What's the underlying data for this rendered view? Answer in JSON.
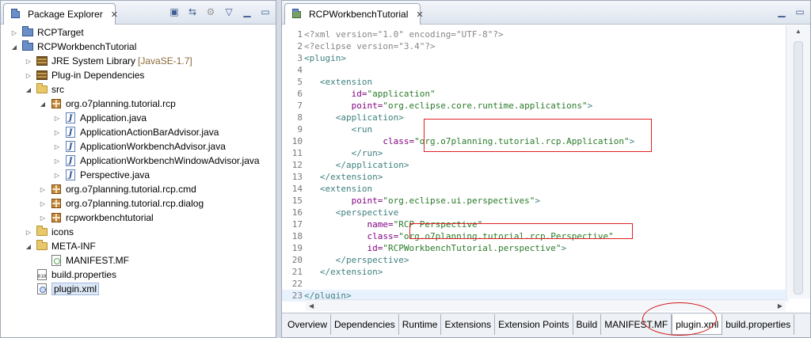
{
  "explorer": {
    "title": "Package Explorer",
    "tree": [
      {
        "label": "RCPTarget",
        "depth": 0,
        "icon": "project-icon",
        "twisty": "collapsed"
      },
      {
        "label": "RCPWorkbenchTutorial",
        "depth": 0,
        "icon": "project-icon",
        "twisty": "expanded"
      },
      {
        "label": "JRE System Library",
        "decoration": "[JavaSE-1.7]",
        "depth": 1,
        "icon": "library-icon",
        "twisty": "collapsed"
      },
      {
        "label": "Plug-in Dependencies",
        "depth": 1,
        "icon": "library-icon",
        "twisty": "collapsed"
      },
      {
        "label": "src",
        "depth": 1,
        "icon": "source-folder-icon",
        "twisty": "expanded"
      },
      {
        "label": "org.o7planning.tutorial.rcp",
        "depth": 2,
        "icon": "package-icon",
        "twisty": "expanded"
      },
      {
        "label": "Application.java",
        "depth": 3,
        "icon": "java-file-icon",
        "twisty": "collapsed"
      },
      {
        "label": "ApplicationActionBarAdvisor.java",
        "depth": 3,
        "icon": "java-file-icon",
        "twisty": "collapsed"
      },
      {
        "label": "ApplicationWorkbenchAdvisor.java",
        "depth": 3,
        "icon": "java-file-icon",
        "twisty": "collapsed"
      },
      {
        "label": "ApplicationWorkbenchWindowAdvisor.java",
        "depth": 3,
        "icon": "java-file-icon",
        "twisty": "collapsed"
      },
      {
        "label": "Perspective.java",
        "depth": 3,
        "icon": "java-file-icon",
        "twisty": "collapsed"
      },
      {
        "label": "org.o7planning.tutorial.rcp.cmd",
        "depth": 2,
        "icon": "package-icon",
        "twisty": "collapsed"
      },
      {
        "label": "org.o7planning.tutorial.rcp.dialog",
        "depth": 2,
        "icon": "package-icon",
        "twisty": "collapsed"
      },
      {
        "label": "rcpworkbenchtutorial",
        "depth": 2,
        "icon": "package-icon",
        "twisty": "collapsed"
      },
      {
        "label": "icons",
        "depth": 1,
        "icon": "folder-icon",
        "twisty": "collapsed"
      },
      {
        "label": "META-INF",
        "depth": 1,
        "icon": "folder-icon",
        "twisty": "expanded"
      },
      {
        "label": "MANIFEST.MF",
        "depth": 2,
        "icon": "manifest-file-icon",
        "twisty": "none"
      },
      {
        "label": "build.properties",
        "depth": 1,
        "icon": "properties-file-icon",
        "twisty": "none"
      },
      {
        "label": "plugin.xml",
        "depth": 1,
        "icon": "xml-file-icon",
        "twisty": "none",
        "selected": true
      }
    ]
  },
  "editor": {
    "title": "RCPWorkbenchTutorial",
    "lines": [
      {
        "n": "1",
        "parts": [
          [
            "pi",
            "<?xml version=\"1.0\" encoding=\"UTF-8\"?>"
          ]
        ]
      },
      {
        "n": "2",
        "parts": [
          [
            "pi",
            "<?eclipse version=\"3.4\"?>"
          ]
        ]
      },
      {
        "n": "3",
        "parts": [
          [
            "tag",
            "<plugin>"
          ]
        ]
      },
      {
        "n": "4",
        "parts": []
      },
      {
        "n": "5",
        "parts": [
          [
            "sp",
            "   "
          ],
          [
            "tag",
            "<extension"
          ]
        ]
      },
      {
        "n": "6",
        "parts": [
          [
            "sp",
            "         "
          ],
          [
            "attr",
            "id="
          ],
          [
            "val",
            "\"application\""
          ]
        ]
      },
      {
        "n": "7",
        "parts": [
          [
            "sp",
            "         "
          ],
          [
            "attr",
            "point="
          ],
          [
            "val",
            "\"org.eclipse.core.runtime.applications\""
          ],
          [
            "tag",
            ">"
          ]
        ]
      },
      {
        "n": "8",
        "parts": [
          [
            "sp",
            "      "
          ],
          [
            "tag",
            "<application>"
          ]
        ]
      },
      {
        "n": "9",
        "parts": [
          [
            "sp",
            "         "
          ],
          [
            "tag",
            "<run"
          ]
        ]
      },
      {
        "n": "10",
        "parts": [
          [
            "sp",
            "               "
          ],
          [
            "attr",
            "class="
          ],
          [
            "val",
            "\"org.o7planning.tutorial.rcp.Application\""
          ],
          [
            "tag",
            ">"
          ]
        ]
      },
      {
        "n": "11",
        "parts": [
          [
            "sp",
            "         "
          ],
          [
            "tag",
            "</run>"
          ]
        ]
      },
      {
        "n": "12",
        "parts": [
          [
            "sp",
            "      "
          ],
          [
            "tag",
            "</application>"
          ]
        ]
      },
      {
        "n": "13",
        "parts": [
          [
            "sp",
            "   "
          ],
          [
            "tag",
            "</extension>"
          ]
        ]
      },
      {
        "n": "14",
        "parts": [
          [
            "sp",
            "   "
          ],
          [
            "tag",
            "<extension"
          ]
        ]
      },
      {
        "n": "15",
        "parts": [
          [
            "sp",
            "         "
          ],
          [
            "attr",
            "point="
          ],
          [
            "val",
            "\"org.eclipse.ui.perspectives\""
          ],
          [
            "tag",
            ">"
          ]
        ]
      },
      {
        "n": "16",
        "parts": [
          [
            "sp",
            "      "
          ],
          [
            "tag",
            "<perspective"
          ]
        ]
      },
      {
        "n": "17",
        "parts": [
          [
            "sp",
            "            "
          ],
          [
            "attr",
            "name="
          ],
          [
            "val",
            "\"RCP Perspective\""
          ]
        ]
      },
      {
        "n": "18",
        "parts": [
          [
            "sp",
            "            "
          ],
          [
            "attr",
            "class="
          ],
          [
            "val",
            "\"org.o7planning.tutorial.rcp.Perspective\""
          ]
        ]
      },
      {
        "n": "19",
        "parts": [
          [
            "sp",
            "            "
          ],
          [
            "attr",
            "id="
          ],
          [
            "val",
            "\"RCPWorkbenchTutorial.perspective\""
          ],
          [
            "tag",
            ">"
          ]
        ]
      },
      {
        "n": "20",
        "parts": [
          [
            "sp",
            "      "
          ],
          [
            "tag",
            "</perspective>"
          ]
        ]
      },
      {
        "n": "21",
        "parts": [
          [
            "sp",
            "   "
          ],
          [
            "tag",
            "</extension>"
          ]
        ]
      },
      {
        "n": "22",
        "parts": []
      },
      {
        "n": "23",
        "parts": [
          [
            "tag",
            "</plugin>"
          ]
        ]
      }
    ],
    "highlighted_line": "23",
    "tabs": [
      "Overview",
      "Dependencies",
      "Runtime",
      "Extensions",
      "Extension Points",
      "Build",
      "MANIFEST.MF",
      "plugin.xml",
      "build.properties"
    ],
    "active_tab": "plugin.xml"
  },
  "colors": {
    "tag": "#3f7f7f",
    "attr": "#7f007f",
    "value": "#2a7a2a",
    "pi": "#878787",
    "annotation": "#e02020"
  }
}
